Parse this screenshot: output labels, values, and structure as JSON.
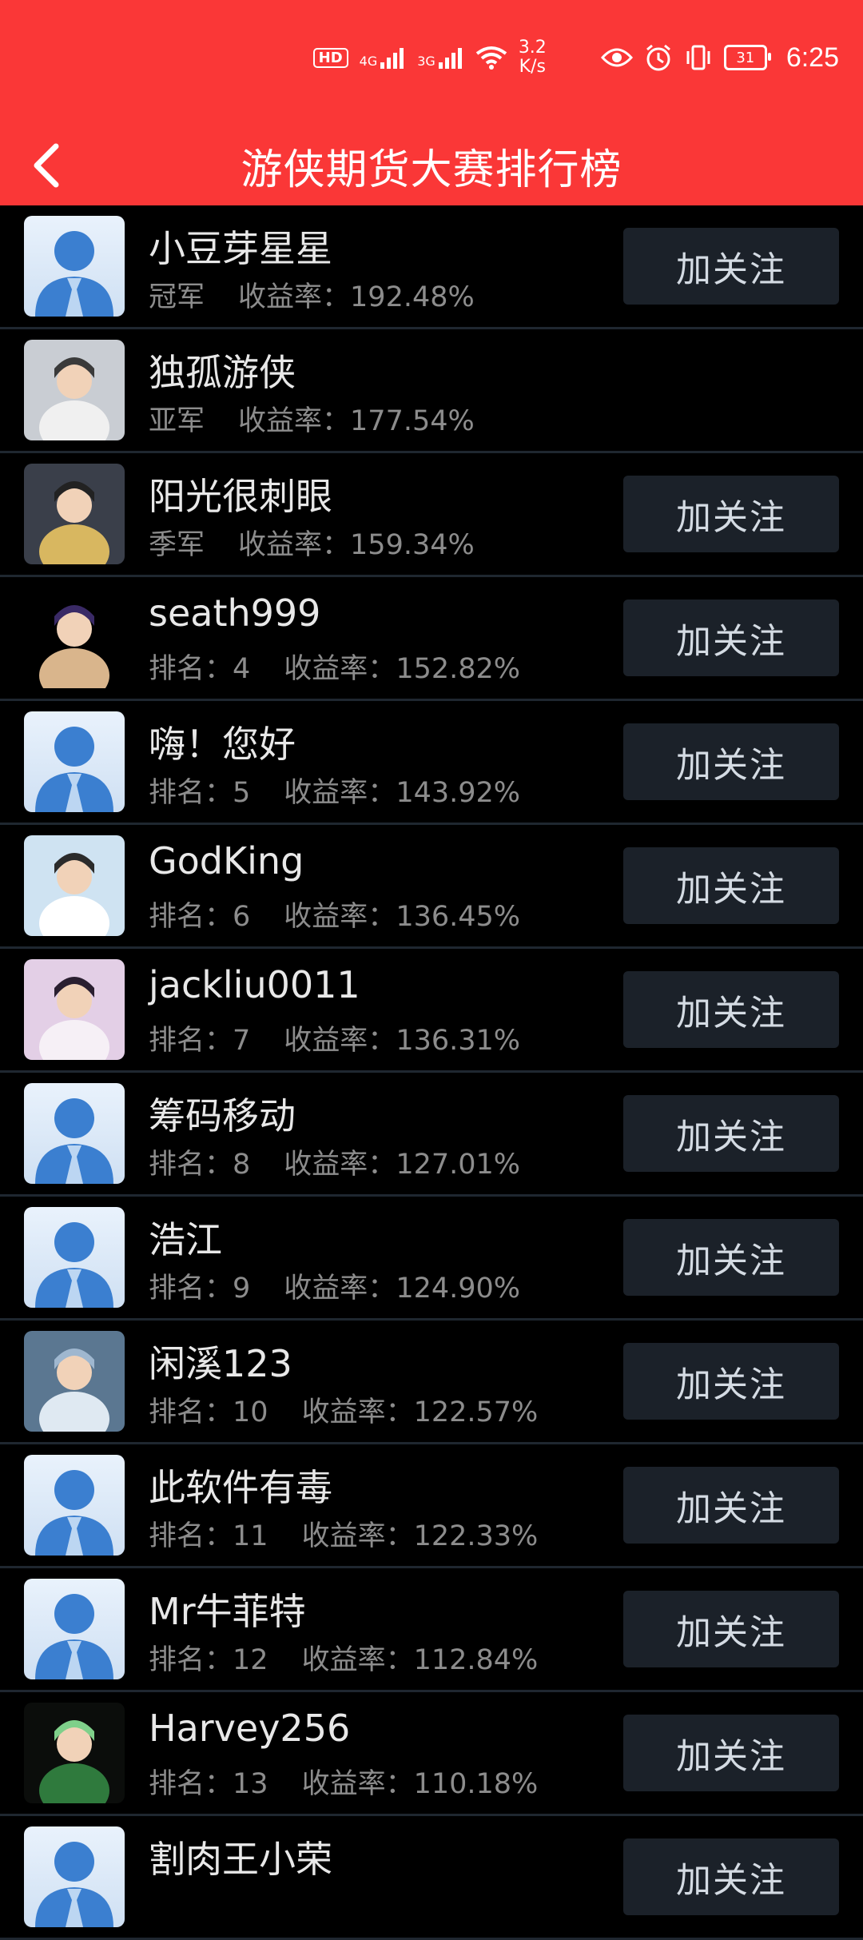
{
  "status_bar": {
    "network_speed_value": "3.2",
    "network_speed_unit": "K/s",
    "battery": "31",
    "time": "6:25",
    "hd_badge": "HD",
    "signal1": "4G",
    "signal2": "3G"
  },
  "header": {
    "title": "游侠期货大赛排行榜"
  },
  "labels": {
    "rate_label": "收益率：",
    "rank_label": "排名：",
    "follow": "加关注"
  },
  "colors": {
    "header_bg": "#fa3737",
    "row_divider": "#1f2730",
    "button_bg": "#1b2129"
  },
  "rankings": [
    {
      "name": "小豆芽星星",
      "rank_text": "冠军",
      "rate": "192.48%",
      "avatar": "default-avatar",
      "follow": true
    },
    {
      "name": "独孤游侠",
      "rank_text": "亚军",
      "rate": "177.54%",
      "avatar": "swordsman-white-avatar",
      "follow": false
    },
    {
      "name": "阳光很刺眼",
      "rank_text": "季军",
      "rate": "159.34%",
      "avatar": "swordsman-gold-avatar",
      "follow": true
    },
    {
      "name": "seath999",
      "rank_text": "4",
      "rate": "152.82%",
      "avatar": "cartoon-hero-avatar",
      "follow": true
    },
    {
      "name": "嗨！您好",
      "rank_text": "5",
      "rate": "143.92%",
      "avatar": "default-avatar",
      "follow": true
    },
    {
      "name": "GodKing",
      "rank_text": "6",
      "rate": "136.45%",
      "avatar": "lady-white-avatar",
      "follow": true
    },
    {
      "name": "jackliu0011",
      "rank_text": "7",
      "rate": "136.31%",
      "avatar": "lady-blossom-avatar",
      "follow": true
    },
    {
      "name": "筹码移动",
      "rank_text": "8",
      "rate": "127.01%",
      "avatar": "default-avatar",
      "follow": true
    },
    {
      "name": "浩江",
      "rank_text": "9",
      "rate": "124.90%",
      "avatar": "default-avatar",
      "follow": true
    },
    {
      "name": "闲溪123",
      "rank_text": "10",
      "rate": "122.57%",
      "avatar": "silver-knight-avatar",
      "follow": true
    },
    {
      "name": "此软件有毒",
      "rank_text": "11",
      "rate": "122.33%",
      "avatar": "default-avatar",
      "follow": true
    },
    {
      "name": "Mr牛菲特",
      "rank_text": "12",
      "rate": "112.84%",
      "avatar": "default-avatar",
      "follow": true
    },
    {
      "name": "Harvey256",
      "rank_text": "13",
      "rate": "110.18%",
      "avatar": "jade-dragon-avatar",
      "follow": true
    },
    {
      "name": "割肉王小荣",
      "rank_text": "",
      "rate": "",
      "avatar": "default-avatar",
      "follow": true
    }
  ]
}
